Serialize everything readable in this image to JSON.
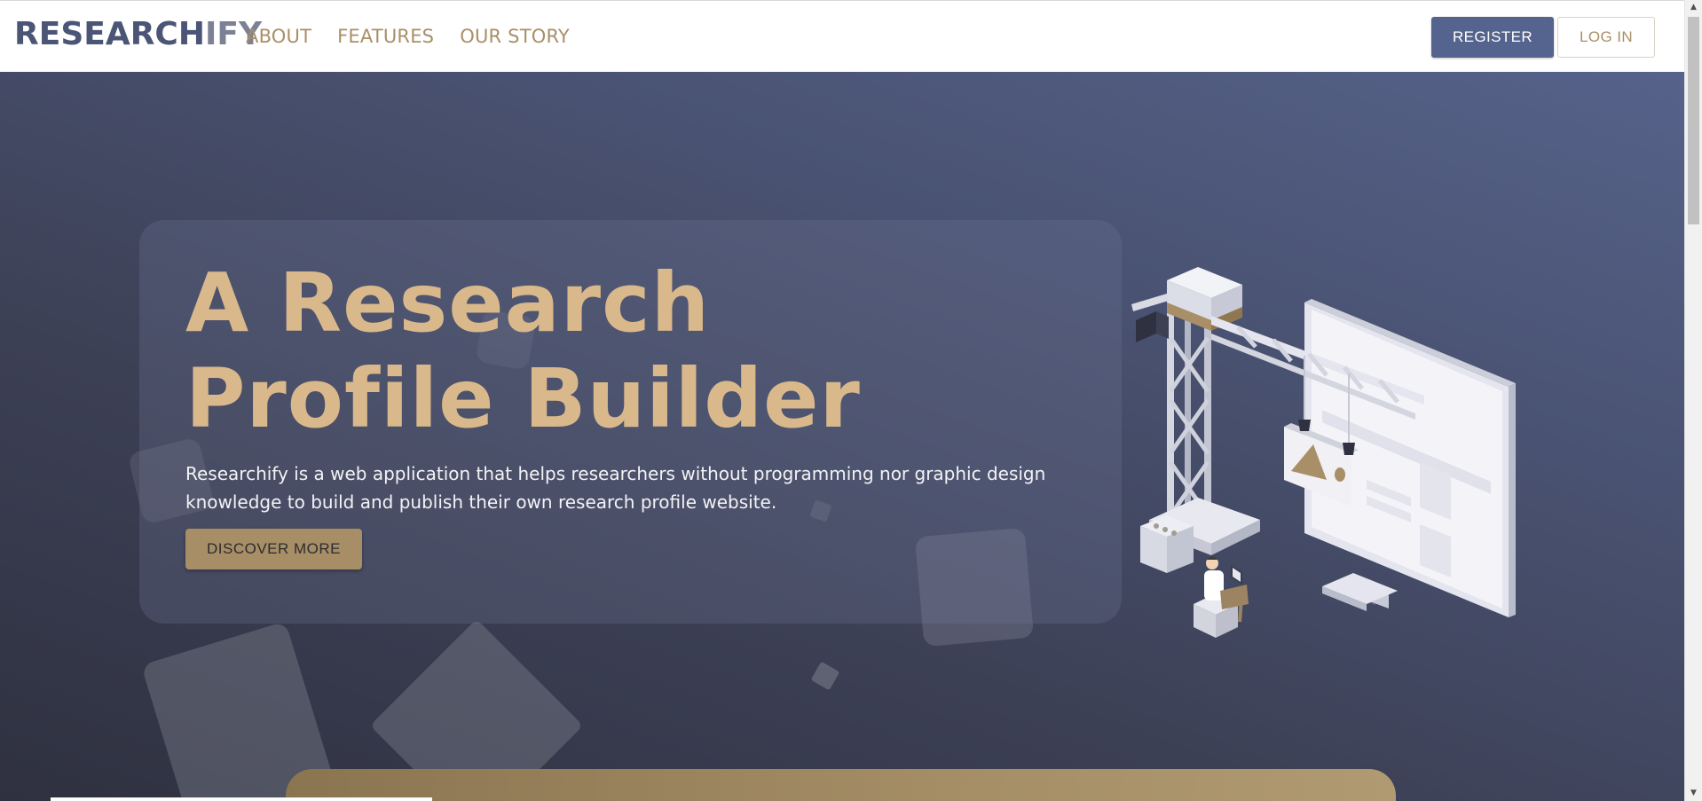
{
  "navbar": {
    "brand_part1": "RESEARCH",
    "brand_part2": "IFY",
    "links": [
      {
        "label": "ABOUT"
      },
      {
        "label": "FEATURES"
      },
      {
        "label": "OUR STORY"
      }
    ],
    "register_label": "REGISTER",
    "login_label": "LOG IN"
  },
  "hero": {
    "title": "A Research Profile Builder",
    "description": "Researchify is a web application that helps researchers without programming nor graphic design knowledge to build and publish their own research profile website.",
    "cta_label": "DISCOVER MORE",
    "illustration_icon": "crane-building-website-illustration"
  },
  "scrollbar": {
    "up_icon": "arrow-up-icon",
    "down_icon": "arrow-down-icon"
  },
  "colors": {
    "brand_dark": "#4b5575",
    "accent_gold": "#a98f67",
    "title_gold": "#d9b88b",
    "register_bg": "#55648e",
    "hero_bg_top": "#56628a",
    "hero_bg_bottom": "#2f3140"
  }
}
